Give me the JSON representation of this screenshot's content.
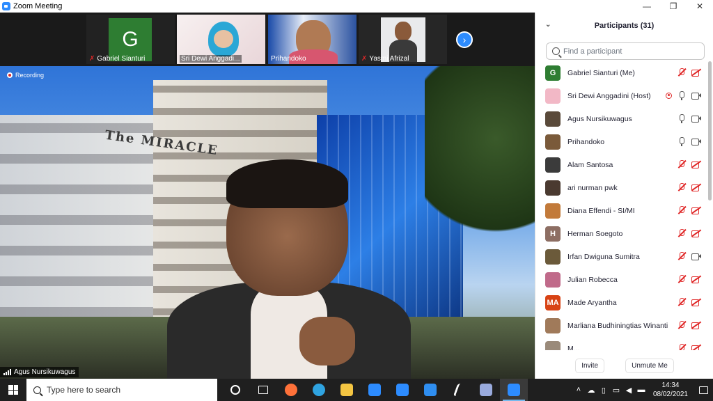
{
  "window": {
    "title": "Zoom Meeting",
    "minimize": "—",
    "maximize": "❐",
    "close": "✕"
  },
  "strip": {
    "thumbs": [
      {
        "name": "Gabriel Sianturi",
        "initial": "G",
        "muted": true
      },
      {
        "name": "Sri Dewi  Anggadi...",
        "muted": false
      },
      {
        "name": "Prihandoko",
        "muted": false
      },
      {
        "name": "Yasmi Afrizal",
        "muted": true
      }
    ],
    "next_icon": "›"
  },
  "main": {
    "recording_label": "Recording",
    "speaker_name": "Agus Nursikuwagus",
    "sign_text": "The MIRACLE"
  },
  "panel": {
    "title": "Participants (31)",
    "collapse_icon": "chevron-down-icon",
    "search_placeholder": "Find a participant",
    "participants": [
      {
        "name": "Gabriel Sianturi (Me)",
        "initial": "G",
        "color": "#2e7d32",
        "mic": "muted",
        "cam": "off",
        "rec": false
      },
      {
        "name": "Sri Dewi Anggadini (Host)",
        "initial": "",
        "color": "#f2b8c6",
        "mic": "on",
        "cam": "on",
        "rec": true
      },
      {
        "name": "Agus Nursikuwagus",
        "initial": "",
        "color": "#5a4a3a",
        "mic": "on",
        "cam": "on",
        "rec": false
      },
      {
        "name": "Prihandoko",
        "initial": "",
        "color": "#7a5a3a",
        "mic": "on",
        "cam": "on",
        "rec": false
      },
      {
        "name": "Alam Santosa",
        "initial": "",
        "color": "#3b3b3b",
        "mic": "muted",
        "cam": "off",
        "rec": false
      },
      {
        "name": "ari nurman pwk",
        "initial": "",
        "color": "#4a3a30",
        "mic": "muted",
        "cam": "off",
        "rec": false
      },
      {
        "name": "Diana Effendi - SI/MI",
        "initial": "",
        "color": "#c27a3a",
        "mic": "muted",
        "cam": "off",
        "rec": false
      },
      {
        "name": "Herman Soegoto",
        "initial": "H",
        "color": "#8d6e63",
        "mic": "muted",
        "cam": "off",
        "rec": false
      },
      {
        "name": "Irfan Dwiguna Sumitra",
        "initial": "",
        "color": "#6b5a3a",
        "mic": "muted",
        "cam": "on",
        "rec": false
      },
      {
        "name": "Julian Robecca",
        "initial": "",
        "color": "#c06a8a",
        "mic": "muted",
        "cam": "off",
        "rec": false
      },
      {
        "name": "Made Aryantha",
        "initial": "MA",
        "color": "#d84315",
        "mic": "muted",
        "cam": "off",
        "rec": false
      },
      {
        "name": "Marliana Budhiningtias Winanti",
        "initial": "",
        "color": "#a07a5a",
        "mic": "muted",
        "cam": "off",
        "rec": false
      },
      {
        "name": "M...",
        "initial": "",
        "color": "#9a8a7a",
        "mic": "muted",
        "cam": "off",
        "rec": false
      }
    ],
    "invite_label": "Invite",
    "unmute_label": "Unmute Me"
  },
  "taskbar": {
    "search_placeholder": "Type here to search",
    "time": "14:34",
    "date": "08/02/2021",
    "apps": [
      {
        "name": "task-view-icon",
        "color": "#ffffff"
      },
      {
        "name": "widgets-icon",
        "color": "#ffffff"
      },
      {
        "name": "firefox-icon",
        "color": "#ff7139"
      },
      {
        "name": "edge-icon",
        "color": "#2fa3e0"
      },
      {
        "name": "file-explorer-icon",
        "color": "#f4c542"
      },
      {
        "name": "store-icon",
        "color": "#2d8cff"
      },
      {
        "name": "mail-icon",
        "color": "#2d8cff"
      },
      {
        "name": "dropbox-icon",
        "color": "#2f8ef0"
      },
      {
        "name": "app-icon",
        "color": "#ffffff"
      },
      {
        "name": "brush-icon",
        "color": "#9ad"
      },
      {
        "name": "zoom-icon",
        "color": "#2d8cff"
      }
    ]
  }
}
